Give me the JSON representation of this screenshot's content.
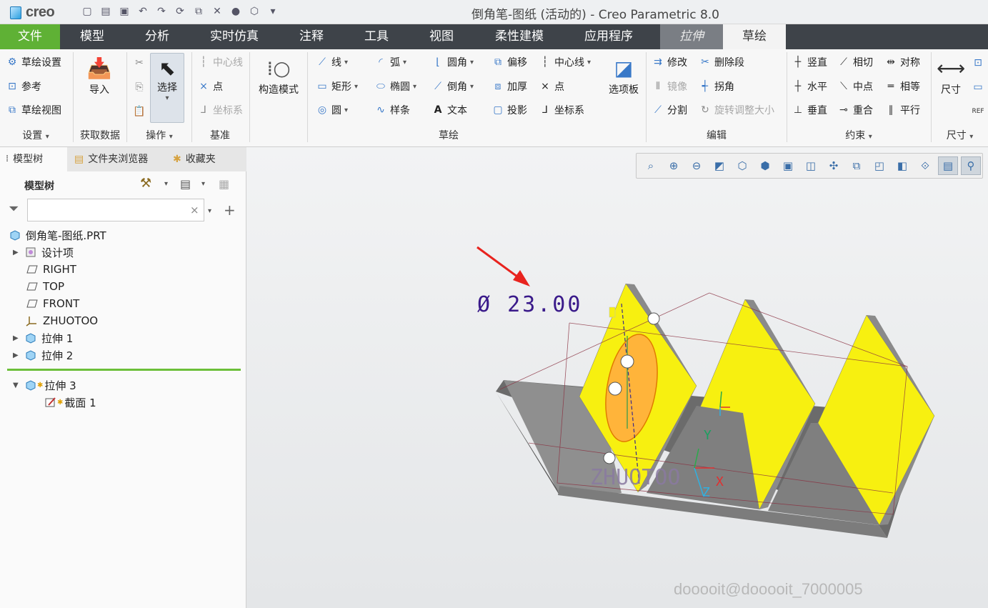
{
  "app": {
    "logo_text": "creo",
    "window_title": "倒角笔-图纸 (活动的) - Creo Parametric 8.0"
  },
  "tabs": [
    {
      "label": "文件"
    },
    {
      "label": "模型"
    },
    {
      "label": "分析"
    },
    {
      "label": "实时仿真"
    },
    {
      "label": "注释"
    },
    {
      "label": "工具"
    },
    {
      "label": "视图"
    },
    {
      "label": "柔性建模"
    },
    {
      "label": "应用程序"
    },
    {
      "label": "拉伸"
    },
    {
      "label": "草绘"
    }
  ],
  "ribbon": {
    "setup": {
      "items": [
        "草绘设置",
        "参考",
        "草绘视图"
      ],
      "label": "设置"
    },
    "getdata": {
      "import": "导入",
      "label": "获取数据"
    },
    "operations": {
      "select": "选择",
      "label": "操作"
    },
    "datum": {
      "items": [
        "中心线",
        "点",
        "坐标系"
      ],
      "label": "基准"
    },
    "construction": "构造模式",
    "sketch": {
      "col1": [
        "线",
        "矩形",
        "圆"
      ],
      "col2": [
        "弧",
        "椭圆",
        "样条"
      ],
      "col3": [
        "圆角",
        "倒角",
        "文本"
      ],
      "col4": [
        "偏移",
        "加厚",
        "投影"
      ],
      "col5": [
        "中心线",
        "点",
        "坐标系"
      ],
      "palette": "选项板",
      "label": "草绘"
    },
    "edit": {
      "items": [
        "修改",
        "删除段",
        "镜像",
        "拐角",
        "分割",
        "旋转调整大小"
      ],
      "label": "编辑"
    },
    "constrain": {
      "items": [
        "竖直",
        "相切",
        "对称",
        "水平",
        "中点",
        "相等",
        "垂直",
        "重合",
        "平行"
      ],
      "label": "约束"
    },
    "dimension": {
      "item": "尺寸",
      "label": "尺寸"
    }
  },
  "left_panel": {
    "tabs": [
      "模型树",
      "文件夹浏览器",
      "收藏夹"
    ],
    "tree_header": "模型树",
    "filter_placeholder": "",
    "tree": [
      "倒角笔-图纸.PRT",
      "设计项",
      "RIGHT",
      "TOP",
      "FRONT",
      "ZHUOTOO",
      "拉伸 1",
      "拉伸 2",
      "拉伸 3",
      "截面 1"
    ]
  },
  "viewport": {
    "dimension_text": "Ø 23.00",
    "csys_label": "ZHUOTOO",
    "axis_x": "X",
    "axis_y": "Y",
    "axis_z": "Z",
    "watermark": "dooooit@dooooit_7000005",
    "colors": {
      "face": "#f7f010",
      "solid": "#8c8c8c",
      "ellipse": "#ffb43a",
      "dim": "#3a1a8a",
      "arrow": "#e8231e"
    }
  }
}
